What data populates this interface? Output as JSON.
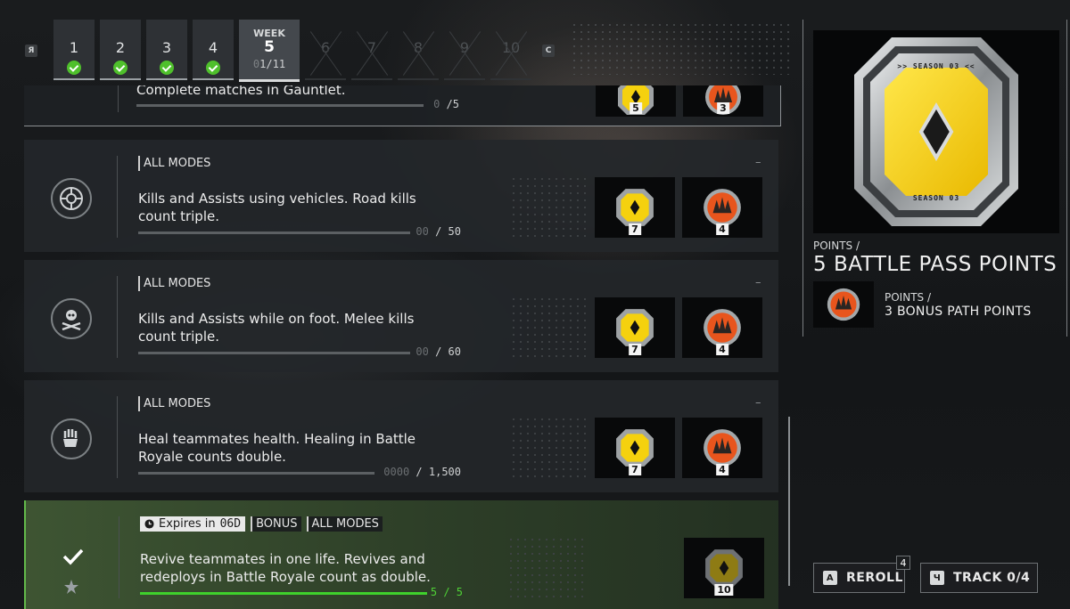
{
  "week_bar": {
    "prev_key": "Я",
    "next_key": "С",
    "tabs": [
      {
        "number": "1",
        "state": "complete"
      },
      {
        "number": "2",
        "state": "complete"
      },
      {
        "number": "3",
        "state": "complete"
      },
      {
        "number": "4",
        "state": "complete"
      },
      {
        "number": "5",
        "state": "current",
        "label": "WEEK",
        "progress_dim": "0",
        "progress": "1/11"
      },
      {
        "number": "6",
        "state": "locked"
      },
      {
        "number": "7",
        "state": "locked"
      },
      {
        "number": "8",
        "state": "locked"
      },
      {
        "number": "9",
        "state": "locked"
      },
      {
        "number": "10",
        "state": "locked"
      }
    ]
  },
  "challenges": [
    {
      "description": "Complete matches in Gauntlet.",
      "progress_dim": "0",
      "progress_total": "/5",
      "progress_fraction": 0.0,
      "rewards": [
        {
          "type": "battle-pass",
          "qty": "5"
        },
        {
          "type": "bonus-path",
          "qty": "3"
        }
      ]
    },
    {
      "icon": "vehicle-icon",
      "tag": "ALL MODES",
      "dash": "–",
      "description": "Kills and Assists using vehicles. Road kills count triple.",
      "progress_dim": "00",
      "progress_total": "/ 50",
      "progress_fraction": 0.0,
      "rewards": [
        {
          "type": "battle-pass",
          "qty": "7"
        },
        {
          "type": "bonus-path",
          "qty": "4"
        }
      ]
    },
    {
      "icon": "skull-crossbones-icon",
      "tag": "ALL MODES",
      "dash": "–",
      "description": "Kills and Assists while on foot. Melee kills count triple.",
      "progress_dim": "00",
      "progress_total": "/ 60",
      "progress_fraction": 0.0,
      "rewards": [
        {
          "type": "battle-pass",
          "qty": "7"
        },
        {
          "type": "bonus-path",
          "qty": "4"
        }
      ]
    },
    {
      "icon": "healing-paw-icon",
      "tag": "ALL MODES",
      "dash": "–",
      "description": "Heal teammates health. Healing in Battle Royale counts double.",
      "progress_dim": "0000",
      "progress_total": "/ 1,500",
      "progress_fraction": 0.0,
      "rewards": [
        {
          "type": "battle-pass",
          "qty": "7"
        },
        {
          "type": "bonus-path",
          "qty": "4"
        }
      ]
    },
    {
      "icon": "checkmark-icon",
      "completed": true,
      "expires_label": "Expires in",
      "expires_value": "06D",
      "tag_bonus": "BONUS",
      "tag": "ALL MODES",
      "description": "Revive teammates in one life. Revives and redeploys in Battle Royale count as double.",
      "progress_value": "5 / 5",
      "progress_fraction": 1.0,
      "rewards": [
        {
          "type": "battle-pass-dark",
          "qty": "10"
        }
      ]
    }
  ],
  "detail": {
    "season_text": ">> SEASON 03 <<",
    "season_short": "SEASON 03",
    "points_label": "POINTS /",
    "points_title": "5 BATTLE PASS POINTS",
    "bonus_label": "POINTS /",
    "bonus_title": "3 BONUS PATH POINTS"
  },
  "actions": {
    "reroll_key": "A",
    "reroll_label": "REROLL",
    "reroll_count": "4",
    "track_key": "Ч",
    "track_label": "TRACK 0/4"
  },
  "colors": {
    "complete_green": "#4fc02c",
    "battle_pass_yellow": "#f5d10e",
    "bonus_orange": "#e8551d"
  }
}
